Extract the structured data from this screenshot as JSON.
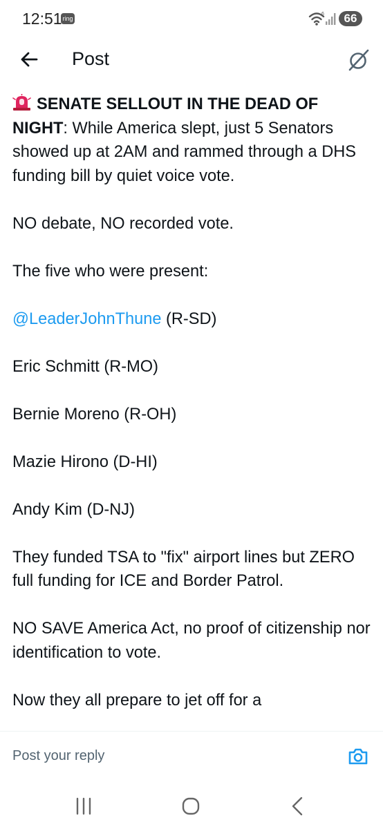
{
  "status_bar": {
    "time": "12:51",
    "notification_app": "ring",
    "battery": "66",
    "icons": [
      "wifi-icon",
      "signal-icon",
      "battery-icon"
    ]
  },
  "header": {
    "title": "Post",
    "back_icon": "arrow-left-icon",
    "grok_icon": "grok-icon"
  },
  "post": {
    "headline_prefix_icon": "siren-emoji",
    "headline": "SENATE SELLOUT IN THE DEAD OF NIGHT",
    "headline_rest": ": While America slept, just 5 Senators showed up at 2AM and rammed through a DHS funding bill by quiet voice vote.",
    "p2": "NO debate, NO recorded vote.",
    "p3": "The five who were present:",
    "senator1_handle": "@LeaderJohnThune",
    "senator1_party": " (R-SD)",
    "senator2": "Eric Schmitt (R-MO)",
    "senator3": "Bernie Moreno (R-OH)",
    "senator4": "Mazie Hirono (D-HI)",
    "senator5": "Andy Kim (D-NJ)",
    "p9": "They funded TSA to \"fix\" airport lines but ZERO full funding for ICE and Border Patrol.",
    "p10": "NO SAVE America Act, no proof of citizenship nor identification to vote.",
    "p11": "Now they all prepare to jet off for a"
  },
  "reply": {
    "placeholder": "Post your reply",
    "camera_icon": "camera-icon"
  },
  "nav": {
    "icons": [
      "recents-icon",
      "home-icon",
      "back-chevron-icon"
    ]
  },
  "colors": {
    "link": "#1d9bf0",
    "accent": "#1d9bf0",
    "text": "#0f1419",
    "muted": "#536471",
    "siren": "#e0245e"
  }
}
